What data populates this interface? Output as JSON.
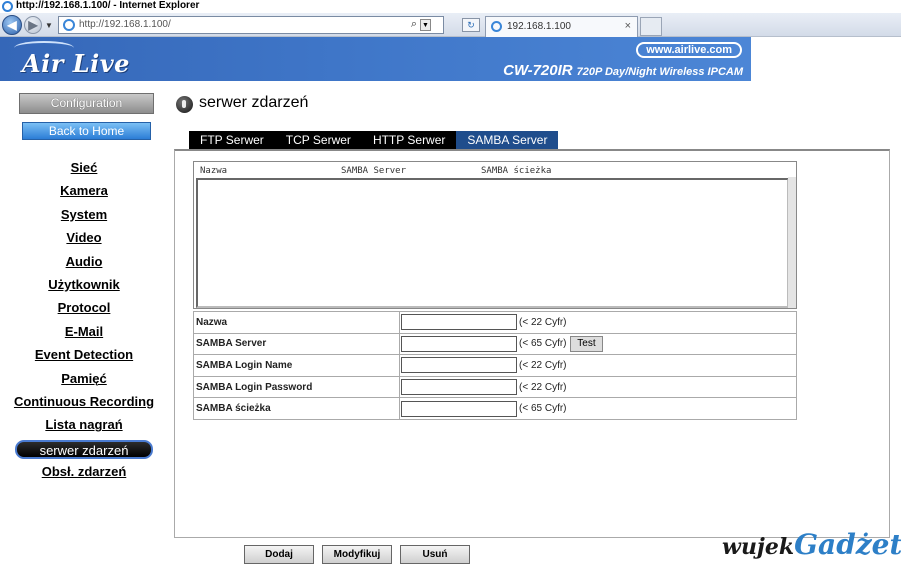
{
  "browser": {
    "window_title": "http://192.168.1.100/ - Internet Explorer",
    "url": "http://192.168.1.100/",
    "tab_label": "192.168.1.100",
    "tab_close": "×"
  },
  "banner": {
    "logo": "Air Live",
    "site": "www.airlive.com",
    "model_code": "CW-720IR",
    "model_desc": "720P Day/Night Wireless IPCAM"
  },
  "sidebar": {
    "config_button": "Configuration",
    "home_button": "Back to Home",
    "items": [
      {
        "label": "Sieć",
        "active": false
      },
      {
        "label": "Kamera",
        "active": false
      },
      {
        "label": "System",
        "active": false
      },
      {
        "label": "Video",
        "active": false
      },
      {
        "label": "Audio",
        "active": false
      },
      {
        "label": "Użytkownik",
        "active": false
      },
      {
        "label": "Protocol",
        "active": false
      },
      {
        "label": "E-Mail",
        "active": false
      },
      {
        "label": "Event Detection",
        "active": false
      },
      {
        "label": "Pamięć",
        "active": false
      },
      {
        "label": "Continuous Recording",
        "active": false
      },
      {
        "label": "Lista nagrań",
        "active": false
      },
      {
        "label": "serwer zdarzeń",
        "active": true
      },
      {
        "label": "Obsł. zdarzeń",
        "active": false
      }
    ]
  },
  "page": {
    "title": "serwer zdarzeń",
    "tabs": [
      {
        "label": "FTP Serwer",
        "active": false
      },
      {
        "label": "TCP Serwer",
        "active": false
      },
      {
        "label": "HTTP Serwer",
        "active": false
      },
      {
        "label": "SAMBA Server",
        "active": true
      }
    ],
    "list_columns": [
      "Nazwa",
      "SAMBA Server",
      "SAMBA ścieżka"
    ],
    "fields": [
      {
        "label": "Nazwa",
        "value": "",
        "hint": "(< 22 Cyfr)",
        "has_test": false
      },
      {
        "label": "SAMBA Server",
        "value": "",
        "hint": "(< 65 Cyfr)",
        "has_test": true
      },
      {
        "label": "SAMBA Login Name",
        "value": "",
        "hint": "(< 22 Cyfr)",
        "has_test": false
      },
      {
        "label": "SAMBA Login Password",
        "value": "",
        "hint": "(< 22 Cyfr)",
        "has_test": false
      },
      {
        "label": "SAMBA ścieżka",
        "value": "",
        "hint": "(< 65 Cyfr)",
        "has_test": false
      }
    ],
    "test_button": "Test",
    "buttons": {
      "add": "Dodaj",
      "modify": "Modyfikuj",
      "delete": "Usuń"
    }
  },
  "watermark": {
    "part1": "wujek",
    "part2": "Gadżet"
  }
}
